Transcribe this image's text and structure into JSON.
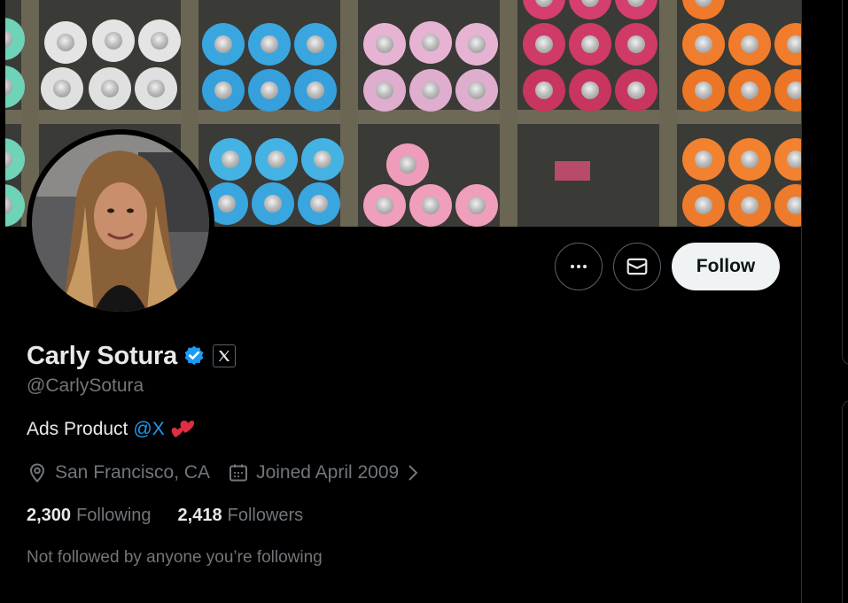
{
  "profile": {
    "display_name": "Carly Sotura",
    "handle": "@CarlySotura",
    "bio_text": "Ads Product",
    "bio_mention": "@X",
    "location": "San Francisco, CA",
    "joined": "Joined April 2009",
    "following_count": "2,300",
    "following_label": "Following",
    "followers_count": "2,418",
    "followers_label": "Followers",
    "not_followed_text": "Not followed by anyone you’re following"
  },
  "actions": {
    "follow_label": "Follow"
  },
  "icons": {
    "more": "more-horizontal-icon",
    "message": "envelope-icon",
    "verified": "verified-badge-icon",
    "affiliate": "x-logo-icon",
    "location": "location-pin-icon",
    "calendar": "calendar-icon",
    "chevron": "chevron-right-icon",
    "heart": "two-hearts-emoji"
  },
  "colors": {
    "accent": "#1d9bf0",
    "background": "#000000",
    "follow_button_bg": "#eff3f4",
    "secondary_text": "#71767b",
    "primary_text": "#e7e9ea"
  }
}
